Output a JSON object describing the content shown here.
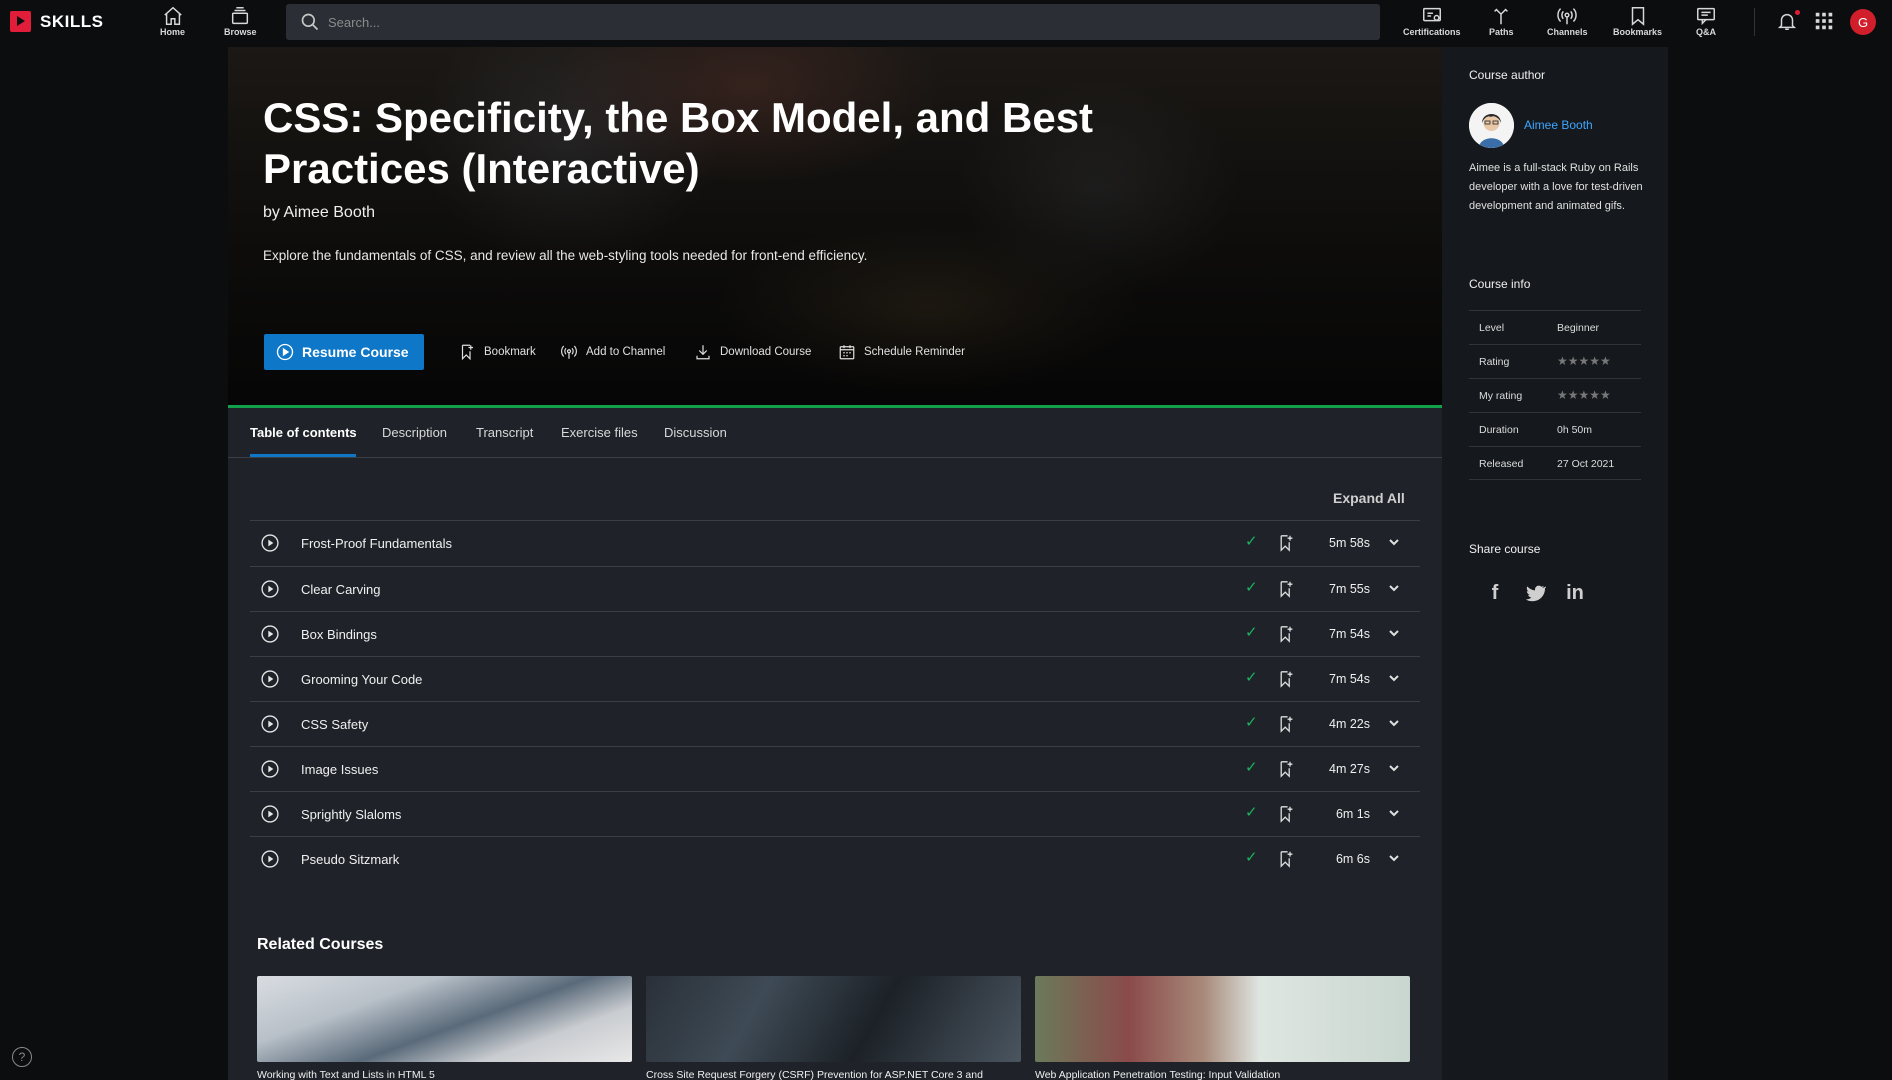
{
  "brand": {
    "name": "SKILLS"
  },
  "nav": {
    "home": "Home",
    "browse": "Browse",
    "certifications": "Certifications",
    "paths": "Paths",
    "channels": "Channels",
    "bookmarks": "Bookmarks",
    "qa": "Q&A",
    "avatar_initial": "G"
  },
  "search": {
    "placeholder": "Search..."
  },
  "course": {
    "title": "CSS: Specificity, the Box Model, and Best Practices (Interactive)",
    "by": "by Aimee Booth",
    "description": "Explore the fundamentals of CSS, and review all the web-styling tools needed for front-end efficiency.",
    "resume_label": "Resume Course",
    "actions": {
      "bookmark": "Bookmark",
      "add_to_channel": "Add to Channel",
      "download": "Download Course",
      "schedule": "Schedule Reminder"
    }
  },
  "tabs": [
    "Table of contents",
    "Description",
    "Transcript",
    "Exercise files",
    "Discussion"
  ],
  "toc": {
    "expand_all": "Expand All",
    "items": [
      {
        "title": "Frost-Proof Fundamentals",
        "duration": "5m 58s"
      },
      {
        "title": "Clear Carving",
        "duration": "7m 55s"
      },
      {
        "title": "Box Bindings",
        "duration": "7m 54s"
      },
      {
        "title": "Grooming Your Code",
        "duration": "7m 54s"
      },
      {
        "title": "CSS Safety",
        "duration": "4m 22s"
      },
      {
        "title": "Image Issues",
        "duration": "4m 27s"
      },
      {
        "title": "Sprightly Slaloms",
        "duration": "6m 1s"
      },
      {
        "title": "Pseudo Sitzmark",
        "duration": "6m 6s"
      }
    ]
  },
  "related": {
    "heading": "Related Courses",
    "items": [
      "Working with Text and Lists in HTML 5",
      "Cross Site Request Forgery (CSRF) Prevention for ASP.NET Core 3 and",
      "Web Application Penetration Testing: Input Validation"
    ]
  },
  "sidebar": {
    "author_heading": "Course author",
    "author_name": "Aimee Booth",
    "author_bio": "Aimee is a full-stack Ruby on Rails developer with a love for test-driven development and animated gifs.",
    "info_heading": "Course info",
    "info": {
      "level_label": "Level",
      "level": "Beginner",
      "rating_label": "Rating",
      "rating_stars": "★★★★★",
      "my_rating_label": "My rating",
      "my_rating_stars": "★★★★★",
      "duration_label": "Duration",
      "duration": "0h 50m",
      "released_label": "Released",
      "released": "27 Oct 2021"
    },
    "share_heading": "Share course",
    "share": {
      "facebook": "f",
      "linkedin": "in"
    }
  },
  "help": "?",
  "colors": {
    "accent": "#0e77c8",
    "brand": "#e21d39",
    "progress": "#13a04a",
    "check": "#19b35a",
    "link": "#3ea6ff"
  }
}
